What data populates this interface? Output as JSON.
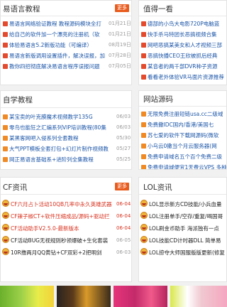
{
  "sections": {
    "yiyuyan": {
      "title": "易语言教程",
      "more": "更多",
      "items": [
        {
          "text": "易语言网络验证教程 教程源码模块全打",
          "date": "01月21日"
        },
        {
          "text": "给自己的软件加一个漂亮的注册机（软",
          "date": "01月21日"
        },
        {
          "text": "体验易语言5.2新版功能（可编译）",
          "date": "08月19日"
        },
        {
          "text": "易语言新版调用设置插件，解决误报，加",
          "date": "07月28日"
        },
        {
          "text": "教你四招彻底解决易语言程序误报问题",
          "date": "07月05日"
        }
      ]
    },
    "zhide": {
      "title": "值得一看",
      "items": [
        {
          "text": "德部的小鸟大电影720P电脑蓝"
        },
        {
          "text": "快手杀马特团长恶搞视频合集"
        },
        {
          "text": "网吧恶搞某美女和人才视频三部"
        },
        {
          "text": "恶搞快播CEO王欣被抓后经典"
        },
        {
          "text": "某音者的两千部DVR种子资源"
        },
        {
          "text": "看看老外体验VR马面片资源推荐"
        }
      ]
    },
    "ziyuan": {
      "title": "自学教程",
      "items": [
        {
          "text": "某宝卖的叶克膜魔术视频教学135G",
          "date": "06/03"
        },
        {
          "text": "零鸟也能狂之汇编系列VIP培训教程(80集",
          "date": "06/03"
        },
        {
          "text": "某黑客网吧入侵系列全套教程",
          "date": "05/30"
        },
        {
          "text": "大气PPT模板全套打包+幻灯片制作视频教",
          "date": "05/27"
        },
        {
          "text": "网正易语言基础系+进阶列全集教程",
          "date": "05/25"
        }
      ]
    },
    "wangzhan": {
      "title": "网站源码",
      "items": [
        {
          "text": "无限免费注册短链usa.cc二级域"
        },
        {
          "text": "免费撒IDC国内/香港/美国七"
        },
        {
          "text": "苏七爱的软件下载网源码(微软"
        },
        {
          "text": "小乌云0撒当个月云服务器(网"
        },
        {
          "text": "免费申请域名五个百个免费二级"
        },
        {
          "text": "免费申请域便宜1天费云VPS 多种"
        }
      ]
    },
    "cf": {
      "title": "CF资讯",
      "more": "更多",
      "items": [
        {
          "text": "CF六月占卜活动10QB几率中永久英雄武器",
          "date": "06-04",
          "color": "red"
        },
        {
          "text": "CF辣子椒CT+软件压缩成品/源码+驱动拦",
          "date": "06-04",
          "color": "red"
        },
        {
          "text": "CF活动助手V2.5.0-最新版本",
          "date": "06-04",
          "color": "red"
        },
        {
          "text": "CF活动BUG无视规则秒领爆破+生化套装",
          "date": "06-05",
          "color": "dark"
        },
        {
          "text": "10R撸两月QQ黄钻+CF双彩+2把明剑",
          "date": "06-03",
          "color": "dark"
        }
      ]
    },
    "lol": {
      "title": "LOL资讯",
      "items": [
        {
          "text": "LOL显示新方CD技能/小兵血量"
        },
        {
          "text": "LOL注册单手/空存/重复/喝国哥"
        },
        {
          "text": "LOL刷金币助手 海派独有一点"
        },
        {
          "text": "LOL技能CD计时器DLL 简单易"
        },
        {
          "text": "LOL掠夺大师国服版版更新(修复"
        }
      ]
    }
  }
}
